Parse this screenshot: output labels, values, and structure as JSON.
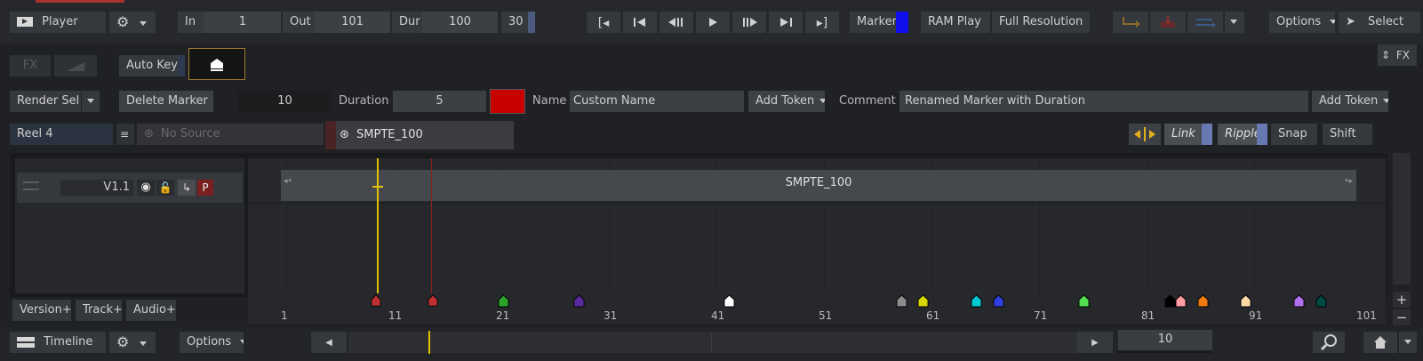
{
  "toolbar": {
    "player_label": "Player",
    "in_label": "In",
    "in_value": "1",
    "out_label": "Out",
    "out_value": "101",
    "dur_label": "Dur",
    "dur_value": "100",
    "fps_value": "30",
    "marker_label": "Marker",
    "ram_play_label": "RAM Play",
    "resolution_label": "Full Resolution",
    "options_label": "Options",
    "select_label": "Select"
  },
  "row2": {
    "fx_label": "FX",
    "auto_key_label": "Auto Key",
    "fx_right_label": "FX"
  },
  "row3": {
    "render_sel_label": "Render Sel",
    "delete_marker_label": "Delete Marker",
    "marker_frame_value": "10",
    "duration_label": "Duration",
    "duration_value": "5",
    "marker_color": "#c80000",
    "name_label": "Name",
    "name_value": "Custom Name",
    "add_token_label": "Add Token",
    "comment_label": "Comment",
    "comment_value": "Renamed Marker with Duration",
    "add_token2_label": "Add Token"
  },
  "row4": {
    "reel_label": "Reel 4",
    "no_source_label": "No Source",
    "tab_label": "SMPTE_100",
    "link_label": "Link",
    "ripple_label": "Ripple",
    "snap_label": "Snap",
    "shift_label": "Shift"
  },
  "track": {
    "name": "V1.1",
    "p_label": "P",
    "clip_label": "SMPTE_100"
  },
  "ruler": {
    "ticks": [
      "1",
      "11",
      "21",
      "31",
      "41",
      "51",
      "61",
      "71",
      "81",
      "91",
      "101"
    ]
  },
  "markers": [
    {
      "frame": 21.5,
      "color": "#2aa52a"
    },
    {
      "frame": 28.5,
      "color": "#5a2aa0"
    },
    {
      "frame": 42.5,
      "color": "#ffffff"
    },
    {
      "frame": 58.5,
      "color": "#8c8c8c"
    },
    {
      "frame": 60.5,
      "color": "#d6d600"
    },
    {
      "frame": 65.5,
      "color": "#00c8d2"
    },
    {
      "frame": 67.5,
      "color": "#3040e0"
    },
    {
      "frame": 75.5,
      "color": "#50e050"
    },
    {
      "frame": 83.5,
      "color": "#000000"
    },
    {
      "frame": 84.5,
      "color": "#ff9aa2"
    },
    {
      "frame": 86.5,
      "color": "#f07a10"
    },
    {
      "frame": 90.5,
      "color": "#ffd8a8"
    },
    {
      "frame": 95.5,
      "color": "#b070f0"
    },
    {
      "frame": 97.5,
      "color": "#004a44"
    }
  ],
  "bottom": {
    "timeline_label": "Timeline",
    "options_label": "Options",
    "frame_value": "10",
    "version_label": "Version+",
    "track_label": "Track+",
    "audio_label": "Audio+"
  }
}
